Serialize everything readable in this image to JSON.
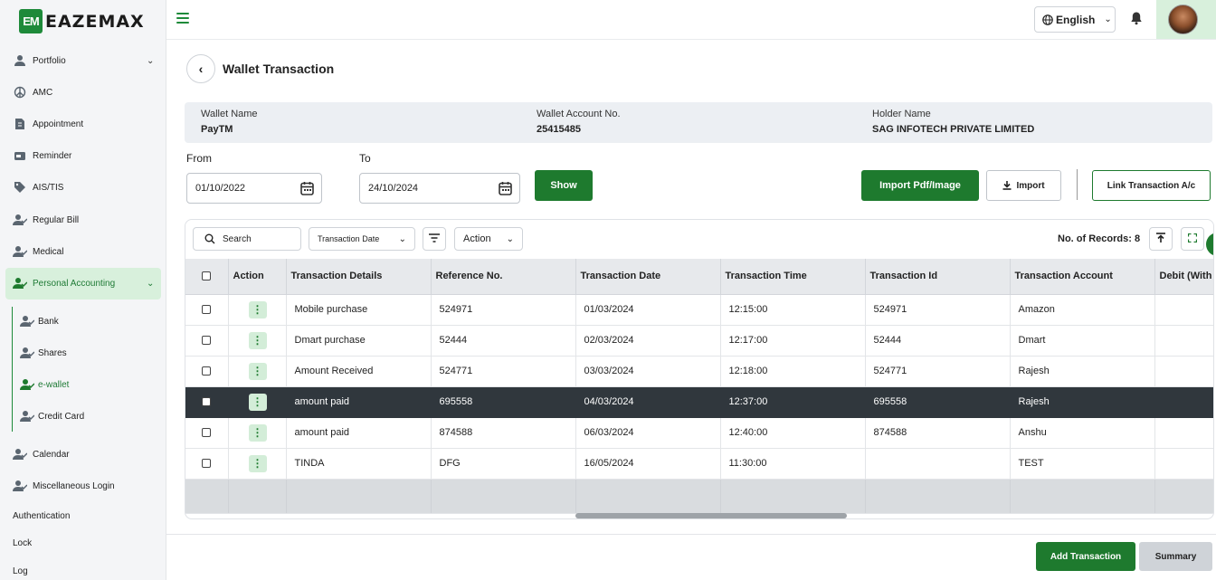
{
  "brand": {
    "name": "EAZEMAX",
    "mark": "EM"
  },
  "header": {
    "language": "English"
  },
  "sidebar": {
    "items": [
      {
        "label": "Portfolio",
        "icon": "user-icon",
        "chevron": true
      },
      {
        "label": "AMC",
        "icon": "peace-icon"
      },
      {
        "label": "Appointment",
        "icon": "document-icon"
      },
      {
        "label": "Reminder",
        "icon": "reminder-icon"
      },
      {
        "label": "AIS/TIS",
        "icon": "tag-icon"
      },
      {
        "label": "Regular Bill",
        "icon": "user-check-icon"
      },
      {
        "label": "Medical",
        "icon": "user-check-icon"
      },
      {
        "label": "Personal Accounting",
        "icon": "user-check-icon",
        "active": true
      }
    ],
    "sub_items": [
      {
        "label": "Bank"
      },
      {
        "label": "Shares"
      },
      {
        "label": "e-wallet",
        "active": true
      },
      {
        "label": "Credit Card"
      }
    ],
    "items_after": [
      {
        "label": "Calendar"
      },
      {
        "label": "Miscellaneous Login"
      }
    ],
    "plain": [
      "Authentication",
      "Lock",
      "Log"
    ]
  },
  "page": {
    "title": "Wallet Transaction"
  },
  "wallet": {
    "name_label": "Wallet Name",
    "name": "PayTM",
    "account_label": "Wallet Account No.",
    "account": "25415485",
    "holder_label": "Holder Name",
    "holder": "SAG INFOTECH PRIVATE LIMITED"
  },
  "filters": {
    "from_label": "From",
    "from": "01/10/2022",
    "to_label": "To",
    "to": "24/10/2024",
    "show_label": "Show"
  },
  "toolbar": {
    "import_pdf": "Import Pdf/Image",
    "import": "Import",
    "link": "Link Transaction A/c"
  },
  "table_tools": {
    "search_placeholder": "Search",
    "date_filter": "Transaction Date",
    "action": "Action",
    "records": "No. of Records: 8"
  },
  "table": {
    "columns": [
      "Action",
      "Transaction Details",
      "Reference No.",
      "Transaction Date",
      "Transaction Time",
      "Transaction Id",
      "Transaction Account",
      "Debit (With"
    ],
    "rows": [
      [
        "Mobile purchase",
        "524971",
        "01/03/2024",
        "12:15:00",
        "524971",
        "Amazon",
        ""
      ],
      [
        "Dmart purchase",
        "52444",
        "02/03/2024",
        "12:17:00",
        "52444",
        "Dmart",
        ""
      ],
      [
        "Amount Received",
        "524771",
        "03/03/2024",
        "12:18:00",
        "524771",
        "Rajesh",
        ""
      ],
      [
        "amount paid",
        "695558",
        "04/03/2024",
        "12:37:00",
        "695558",
        "Rajesh",
        ""
      ],
      [
        "amount paid",
        "874588",
        "06/03/2024",
        "12:40:00",
        "874588",
        "Anshu",
        ""
      ],
      [
        "TINDA",
        "DFG",
        "16/05/2024",
        "11:30:00",
        "",
        "TEST",
        ""
      ]
    ],
    "selected_row": 3
  },
  "footer": {
    "add": "Add Transaction",
    "summary": "Summary"
  },
  "colors": {
    "accent": "#1e7a2e",
    "active_bg": "#d8f0dc",
    "selected_row": "#30373d"
  }
}
